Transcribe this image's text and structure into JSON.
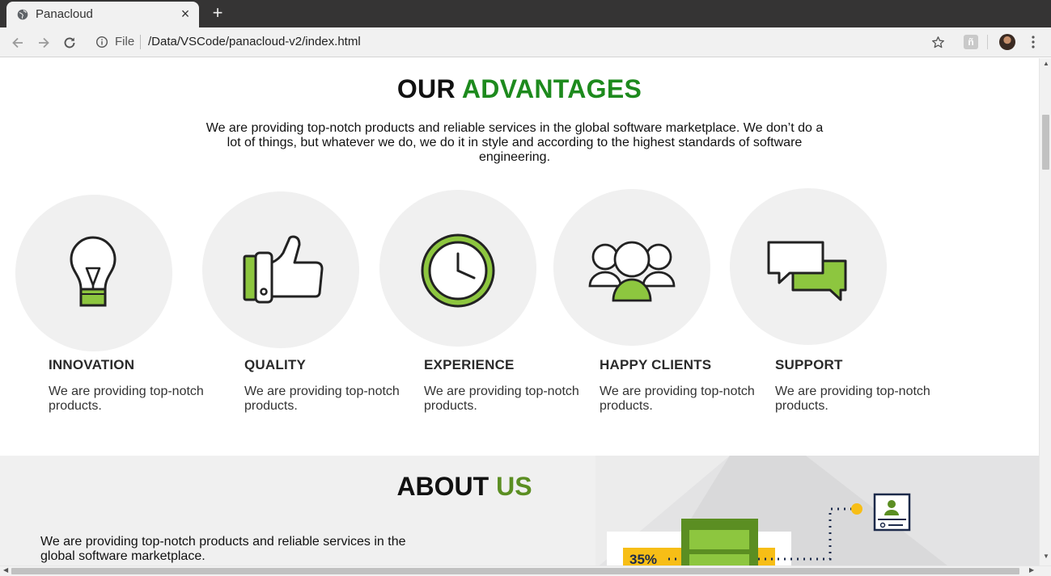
{
  "browser": {
    "tab_title": "Panacloud",
    "scheme_label": "File",
    "url": "/Data/VSCode/panacloud-v2/index.html",
    "extension_badge": "ñ"
  },
  "advantages": {
    "title_prefix": "OUR",
    "title_accent": "ADVANTAGES",
    "description": "We are providing top-notch products and reliable services in the global software marketplace. We don’t do a lot of things, but whatever we do, we do it in style and according to the highest standards of software engineering.",
    "items": [
      {
        "title": "INNOVATION",
        "text": "We are providing top-notch products.",
        "icon": "lightbulb-icon"
      },
      {
        "title": "QUALITY",
        "text": "We are providing top-notch products.",
        "icon": "thumbs-up-icon"
      },
      {
        "title": "EXPERIENCE",
        "text": "We are providing top-notch products.",
        "icon": "clock-icon"
      },
      {
        "title": "HAPPY CLIENTS",
        "text": "We are providing top-notch products.",
        "icon": "group-icon"
      },
      {
        "title": "SUPPORT",
        "text": "We are providing top-notch products.",
        "icon": "chat-bubbles-icon"
      }
    ]
  },
  "about": {
    "title_prefix": "ABOUT",
    "title_accent": "US",
    "description": "We are providing top-notch products and reliable services in the global software marketplace.",
    "illustration_stat": "35%"
  },
  "colors": {
    "accent_green": "#1d8a1d",
    "icon_green": "#8dc63f",
    "about_accent": "#5b8e22",
    "illustration_yellow": "#f7be16"
  }
}
